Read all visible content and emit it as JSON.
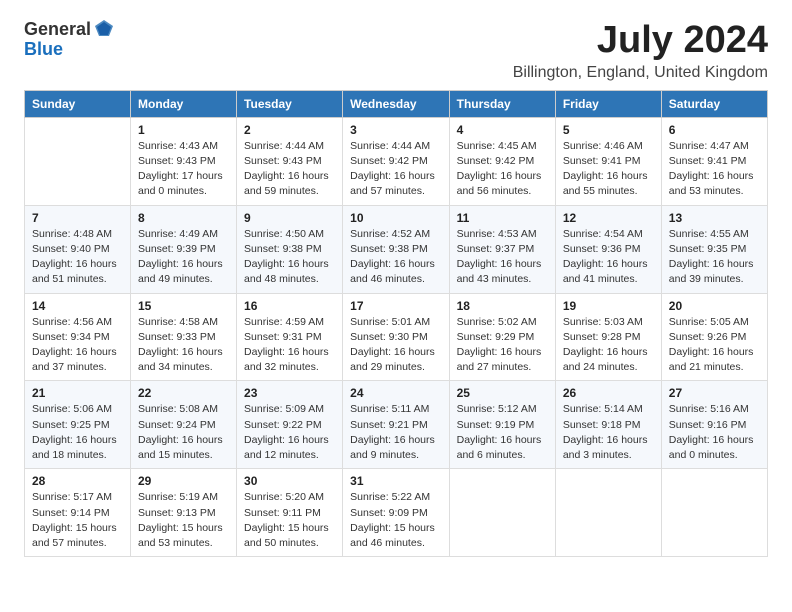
{
  "header": {
    "logo_general": "General",
    "logo_blue": "Blue",
    "month": "July 2024",
    "location": "Billington, England, United Kingdom"
  },
  "weekdays": [
    "Sunday",
    "Monday",
    "Tuesday",
    "Wednesday",
    "Thursday",
    "Friday",
    "Saturday"
  ],
  "weeks": [
    [
      {
        "day": "",
        "info": ""
      },
      {
        "day": "1",
        "info": "Sunrise: 4:43 AM\nSunset: 9:43 PM\nDaylight: 17 hours\nand 0 minutes."
      },
      {
        "day": "2",
        "info": "Sunrise: 4:44 AM\nSunset: 9:43 PM\nDaylight: 16 hours\nand 59 minutes."
      },
      {
        "day": "3",
        "info": "Sunrise: 4:44 AM\nSunset: 9:42 PM\nDaylight: 16 hours\nand 57 minutes."
      },
      {
        "day": "4",
        "info": "Sunrise: 4:45 AM\nSunset: 9:42 PM\nDaylight: 16 hours\nand 56 minutes."
      },
      {
        "day": "5",
        "info": "Sunrise: 4:46 AM\nSunset: 9:41 PM\nDaylight: 16 hours\nand 55 minutes."
      },
      {
        "day": "6",
        "info": "Sunrise: 4:47 AM\nSunset: 9:41 PM\nDaylight: 16 hours\nand 53 minutes."
      }
    ],
    [
      {
        "day": "7",
        "info": "Sunrise: 4:48 AM\nSunset: 9:40 PM\nDaylight: 16 hours\nand 51 minutes."
      },
      {
        "day": "8",
        "info": "Sunrise: 4:49 AM\nSunset: 9:39 PM\nDaylight: 16 hours\nand 49 minutes."
      },
      {
        "day": "9",
        "info": "Sunrise: 4:50 AM\nSunset: 9:38 PM\nDaylight: 16 hours\nand 48 minutes."
      },
      {
        "day": "10",
        "info": "Sunrise: 4:52 AM\nSunset: 9:38 PM\nDaylight: 16 hours\nand 46 minutes."
      },
      {
        "day": "11",
        "info": "Sunrise: 4:53 AM\nSunset: 9:37 PM\nDaylight: 16 hours\nand 43 minutes."
      },
      {
        "day": "12",
        "info": "Sunrise: 4:54 AM\nSunset: 9:36 PM\nDaylight: 16 hours\nand 41 minutes."
      },
      {
        "day": "13",
        "info": "Sunrise: 4:55 AM\nSunset: 9:35 PM\nDaylight: 16 hours\nand 39 minutes."
      }
    ],
    [
      {
        "day": "14",
        "info": "Sunrise: 4:56 AM\nSunset: 9:34 PM\nDaylight: 16 hours\nand 37 minutes."
      },
      {
        "day": "15",
        "info": "Sunrise: 4:58 AM\nSunset: 9:33 PM\nDaylight: 16 hours\nand 34 minutes."
      },
      {
        "day": "16",
        "info": "Sunrise: 4:59 AM\nSunset: 9:31 PM\nDaylight: 16 hours\nand 32 minutes."
      },
      {
        "day": "17",
        "info": "Sunrise: 5:01 AM\nSunset: 9:30 PM\nDaylight: 16 hours\nand 29 minutes."
      },
      {
        "day": "18",
        "info": "Sunrise: 5:02 AM\nSunset: 9:29 PM\nDaylight: 16 hours\nand 27 minutes."
      },
      {
        "day": "19",
        "info": "Sunrise: 5:03 AM\nSunset: 9:28 PM\nDaylight: 16 hours\nand 24 minutes."
      },
      {
        "day": "20",
        "info": "Sunrise: 5:05 AM\nSunset: 9:26 PM\nDaylight: 16 hours\nand 21 minutes."
      }
    ],
    [
      {
        "day": "21",
        "info": "Sunrise: 5:06 AM\nSunset: 9:25 PM\nDaylight: 16 hours\nand 18 minutes."
      },
      {
        "day": "22",
        "info": "Sunrise: 5:08 AM\nSunset: 9:24 PM\nDaylight: 16 hours\nand 15 minutes."
      },
      {
        "day": "23",
        "info": "Sunrise: 5:09 AM\nSunset: 9:22 PM\nDaylight: 16 hours\nand 12 minutes."
      },
      {
        "day": "24",
        "info": "Sunrise: 5:11 AM\nSunset: 9:21 PM\nDaylight: 16 hours\nand 9 minutes."
      },
      {
        "day": "25",
        "info": "Sunrise: 5:12 AM\nSunset: 9:19 PM\nDaylight: 16 hours\nand 6 minutes."
      },
      {
        "day": "26",
        "info": "Sunrise: 5:14 AM\nSunset: 9:18 PM\nDaylight: 16 hours\nand 3 minutes."
      },
      {
        "day": "27",
        "info": "Sunrise: 5:16 AM\nSunset: 9:16 PM\nDaylight: 16 hours\nand 0 minutes."
      }
    ],
    [
      {
        "day": "28",
        "info": "Sunrise: 5:17 AM\nSunset: 9:14 PM\nDaylight: 15 hours\nand 57 minutes."
      },
      {
        "day": "29",
        "info": "Sunrise: 5:19 AM\nSunset: 9:13 PM\nDaylight: 15 hours\nand 53 minutes."
      },
      {
        "day": "30",
        "info": "Sunrise: 5:20 AM\nSunset: 9:11 PM\nDaylight: 15 hours\nand 50 minutes."
      },
      {
        "day": "31",
        "info": "Sunrise: 5:22 AM\nSunset: 9:09 PM\nDaylight: 15 hours\nand 46 minutes."
      },
      {
        "day": "",
        "info": ""
      },
      {
        "day": "",
        "info": ""
      },
      {
        "day": "",
        "info": ""
      }
    ]
  ]
}
